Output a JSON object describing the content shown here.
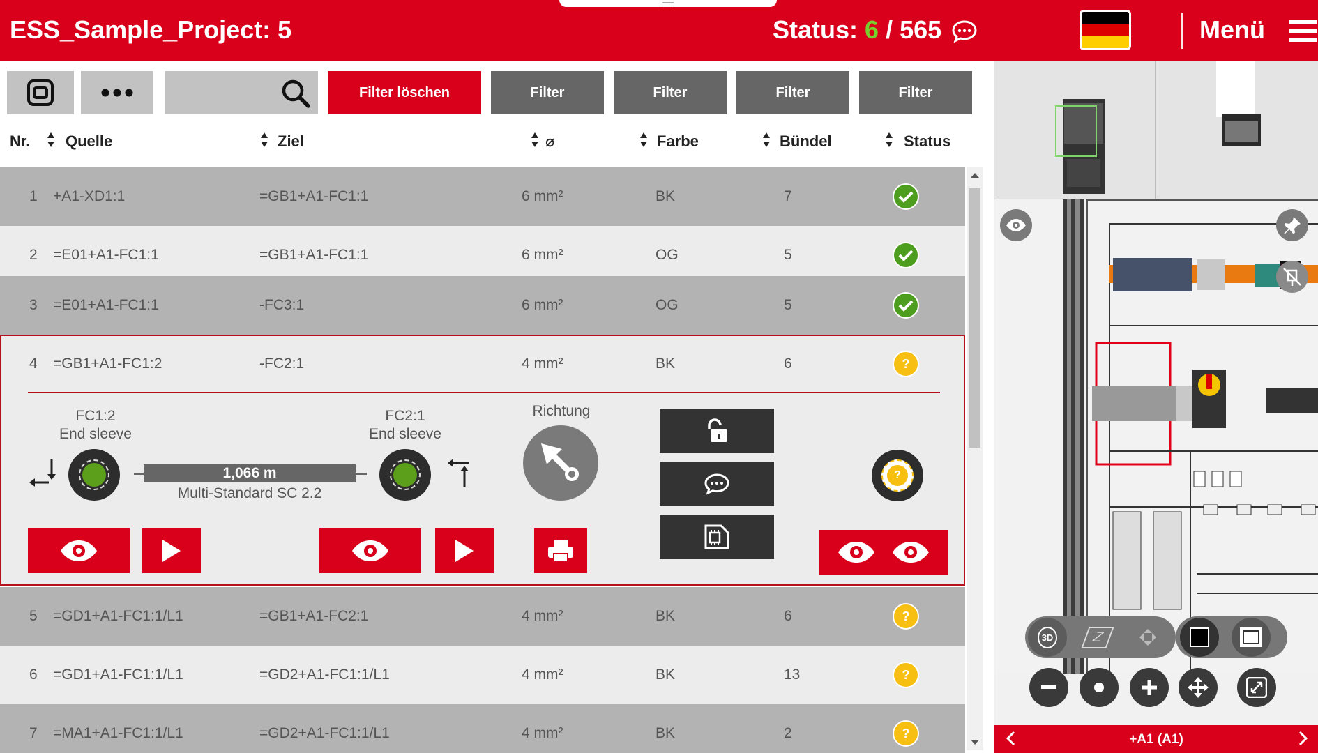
{
  "header": {
    "title": "ESS_Sample_Project: 5",
    "status_label": "Status:",
    "status_done": "6",
    "status_sep": "/",
    "status_total": "565",
    "menu_label": "Menü"
  },
  "toolbar": {
    "filter_clear": "Filter löschen",
    "filter1": "Filter",
    "filter2": "Filter",
    "filter3": "Filter",
    "filter4": "Filter",
    "search_value": ""
  },
  "columns": {
    "nr": "Nr.",
    "source": "Quelle",
    "target": "Ziel",
    "diameter": "⌀",
    "color": "Farbe",
    "bundle": "Bündel",
    "status": "Status"
  },
  "rows": [
    {
      "nr": "1",
      "source": "+A1-XD1:1",
      "target": "=GB1+A1-FC1:1",
      "size": "6 mm²",
      "color": "BK",
      "bundle": "7",
      "status": "done"
    },
    {
      "nr": "2",
      "source": "=E01+A1-FC1:1",
      "target": "=GB1+A1-FC1:1",
      "size": "6 mm²",
      "color": "OG",
      "bundle": "5",
      "status": "done"
    },
    {
      "nr": "3",
      "source": "=E01+A1-FC1:1",
      "target": "-FC3:1",
      "size": "6 mm²",
      "color": "OG",
      "bundle": "5",
      "status": "done"
    },
    {
      "nr": "4",
      "source": "=GB1+A1-FC1:2",
      "target": "-FC2:1",
      "size": "4 mm²",
      "color": "BK",
      "bundle": "6",
      "status": "open"
    },
    {
      "nr": "5",
      "source": "=GD1+A1-FC1:1/L1",
      "target": "=GB1+A1-FC2:1",
      "size": "4 mm²",
      "color": "BK",
      "bundle": "6",
      "status": "open"
    },
    {
      "nr": "6",
      "source": "=GD1+A1-FC1:1/L1",
      "target": "=GD2+A1-FC1:1/L1",
      "size": "4 mm²",
      "color": "BK",
      "bundle": "13",
      "status": "open"
    },
    {
      "nr": "7",
      "source": "=MA1+A1-FC1:1/L1",
      "target": "=GD2+A1-FC1:1/L1",
      "size": "4 mm²",
      "color": "BK",
      "bundle": "2",
      "status": "open"
    }
  ],
  "detail": {
    "left_end": {
      "name": "FC1:2",
      "type": "End sleeve"
    },
    "right_end": {
      "name": "FC2:1",
      "type": "End sleeve"
    },
    "length": "1,066 m",
    "cable": "Multi-Standard SC 2.2",
    "direction_label": "Richtung"
  },
  "viewer": {
    "location": "+A1 (A1)",
    "view_3d": "3D",
    "view_2d": "Z"
  },
  "colors": {
    "brand_red": "#d9001b",
    "status_green": "#76d12e",
    "ok_green": "#4d9e1e",
    "pending_yellow": "#f6bf12"
  }
}
